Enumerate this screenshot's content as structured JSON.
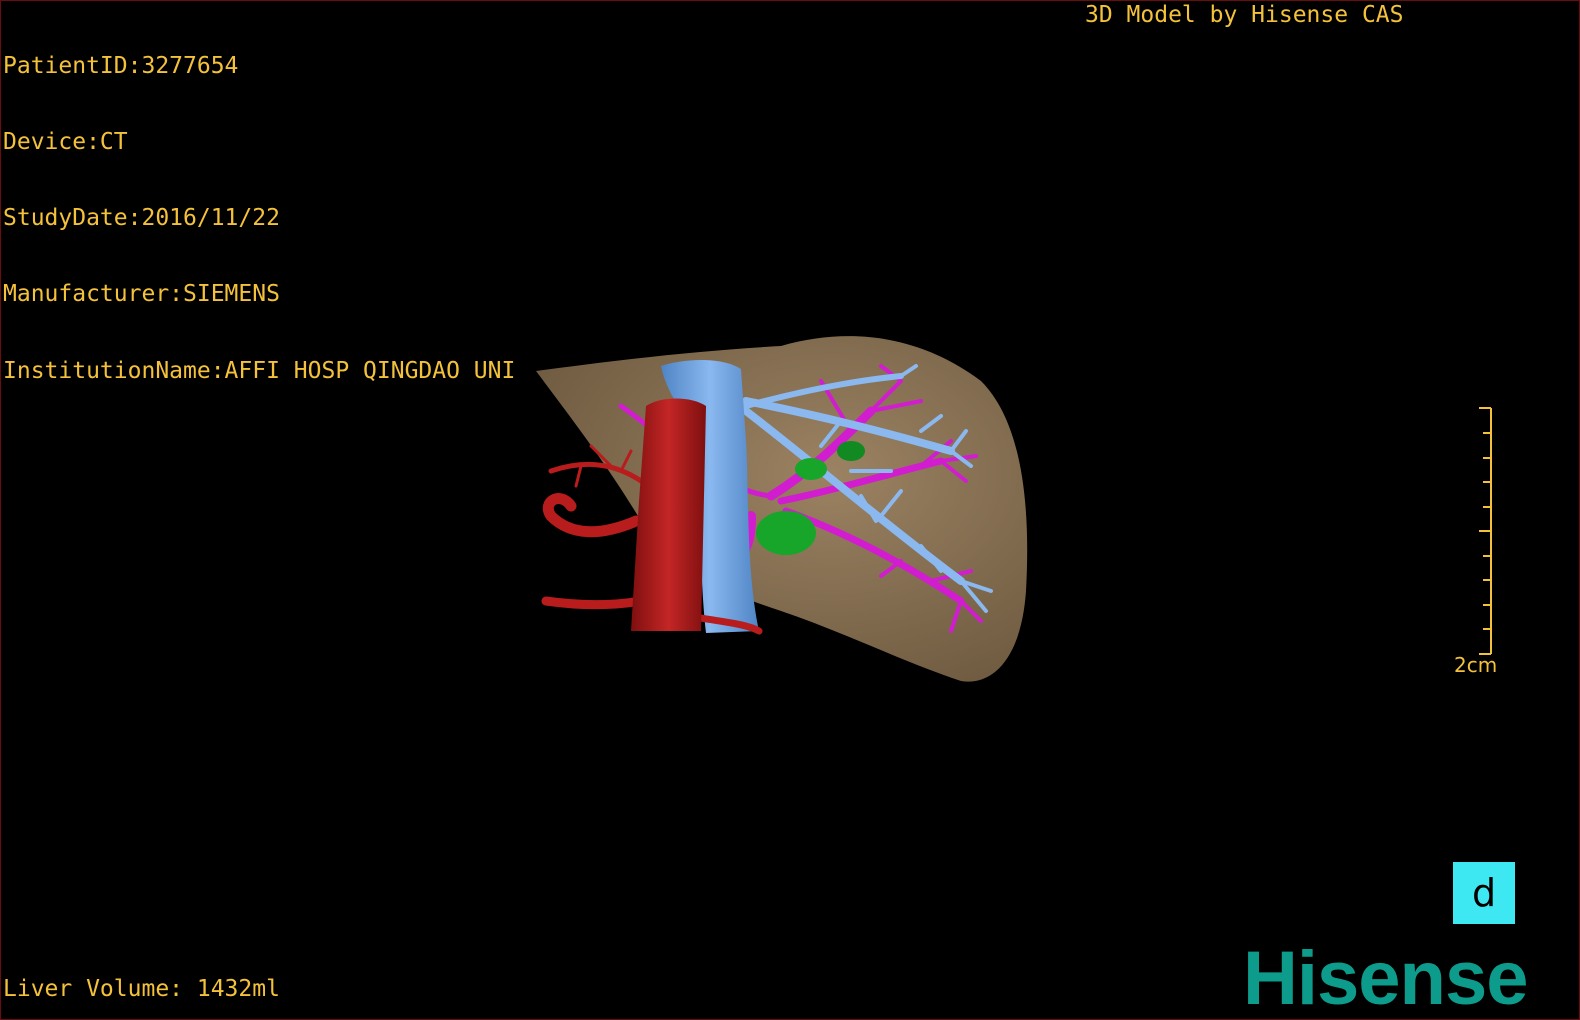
{
  "viewer": {
    "title": "3D Model by Hisense CAS",
    "info": {
      "patient_id": "PatientID:3277654",
      "device": "Device:CT",
      "study_date": "StudyDate:2016/11/22",
      "manufacturer": "Manufacturer:SIEMENS",
      "institution": "InstitutionName:AFFI HOSP QINGDAO UNI"
    },
    "liver_volume": "Liver Volume: 1432ml",
    "scale_label": "2cm",
    "orientation_label": "d",
    "logo_text": "Hisense"
  },
  "colors": {
    "overlay_text": "#f4c23a",
    "liver": "#8a7355",
    "artery": "#b81c1c",
    "vena_cava": "#6ea3e0",
    "portal_vein": "#d21ccf",
    "lesion": "#17a52a",
    "orientation_box": "#3ee8f2",
    "logo": "#0d9b8c"
  }
}
